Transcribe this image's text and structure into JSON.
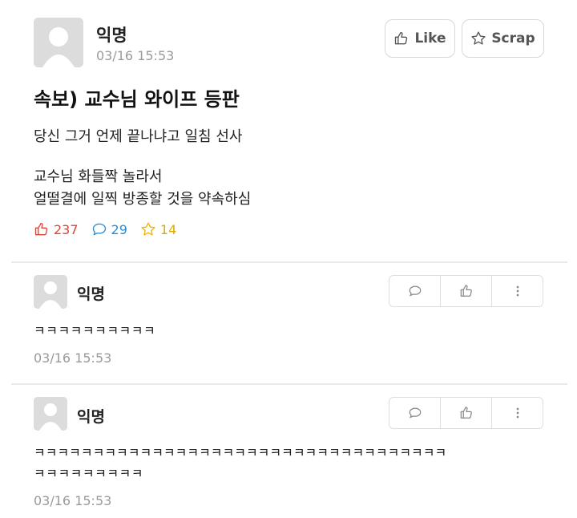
{
  "post": {
    "author": "익명",
    "timestamp": "03/16 15:53",
    "like_label": "Like",
    "scrap_label": "Scrap",
    "title": "속보) 교수님 와이프 등판",
    "body": [
      "당신 그거 언제 끝나냐고 일침 선사",
      "교수님 화들짝 놀라서",
      "얼떨결에 일찍 방종할 것을 약속하심"
    ],
    "stats": {
      "likes": "237",
      "comments": "29",
      "scraps": "14"
    }
  },
  "comments": [
    {
      "author": "익명",
      "lines": [
        "ㅋㅋㅋㅋㅋㅋㅋㅋㅋㅋ"
      ],
      "timestamp": "03/16 15:53"
    },
    {
      "author": "익명",
      "lines": [
        "ㅋㅋㅋㅋㅋㅋㅋㅋㅋㅋㅋㅋㅋㅋㅋㅋㅋㅋㅋㅋㅋㅋㅋㅋㅋㅋㅋㅋㅋㅋㅋㅋㅋㅋㅋ",
        "ㅋㅋㅋㅋㅋㅋㅋㅋㅋ"
      ],
      "timestamp": "03/16 15:53"
    }
  ],
  "colors": {
    "like_red": "#d9453b",
    "comment_blue": "#2a8ccf",
    "scrap_gold": "#f1b400",
    "avatar_bg": "#dcdcdc"
  },
  "icons": {
    "like": "thumbs-up-icon",
    "comment": "speech-bubble-icon",
    "scrap": "star-icon",
    "more": "vertical-dots-icon"
  }
}
